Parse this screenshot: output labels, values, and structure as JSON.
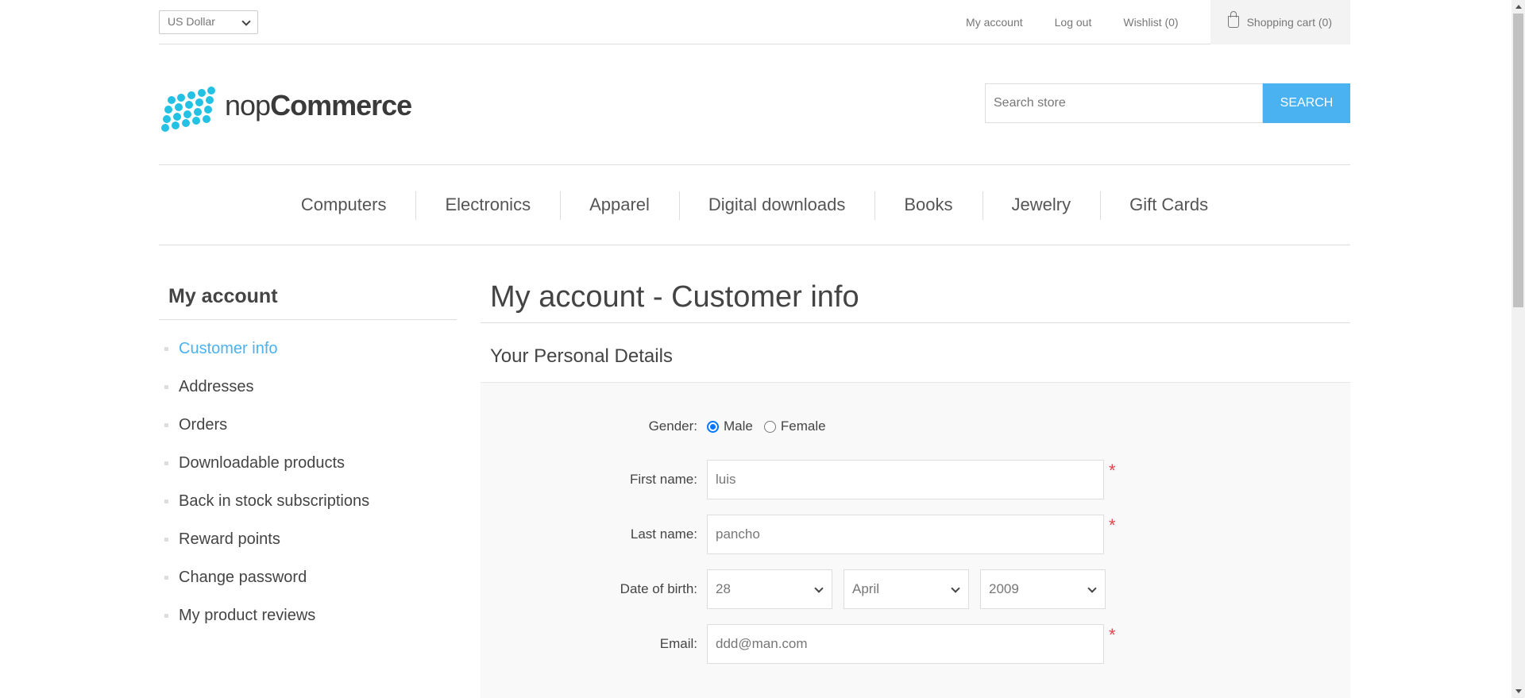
{
  "header": {
    "currency": "US Dollar",
    "links": {
      "my_account": "My account",
      "log_out": "Log out",
      "wishlist": "Wishlist (0)",
      "cart": "Shopping cart (0)"
    },
    "logo": {
      "part1": "nop",
      "part2": "Commerce"
    },
    "search": {
      "placeholder": "Search store",
      "button": "SEARCH"
    }
  },
  "nav": {
    "items": [
      "Computers",
      "Electronics",
      "Apparel",
      "Digital downloads",
      "Books",
      "Jewelry",
      "Gift Cards"
    ]
  },
  "sidebar": {
    "title": "My account",
    "items": [
      "Customer info",
      "Addresses",
      "Orders",
      "Downloadable products",
      "Back in stock subscriptions",
      "Reward points",
      "Change password",
      "My product reviews"
    ]
  },
  "main": {
    "title": "My account - Customer info",
    "section_title": "Your Personal Details",
    "form": {
      "gender_label": "Gender:",
      "gender_male": "Male",
      "gender_female": "Female",
      "first_name_label": "First name:",
      "first_name": "luis",
      "last_name_label": "Last name:",
      "last_name": "pancho",
      "dob_label": "Date of birth:",
      "dob_day": "28",
      "dob_month": "April",
      "dob_year": "2009",
      "email_label": "Email:",
      "email": "ddd@man.com",
      "required_mark": "*"
    }
  },
  "colors": {
    "accent": "#4ab2f1",
    "logo": "#23c1e3",
    "required": "#e4444c"
  }
}
